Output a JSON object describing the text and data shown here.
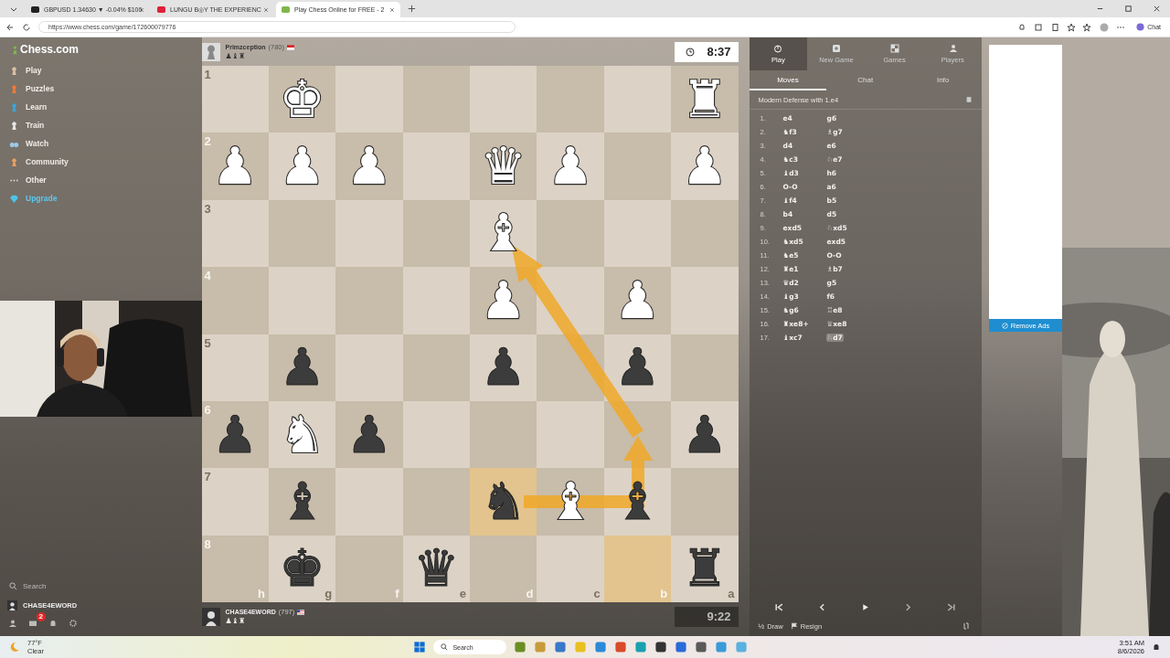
{
  "browser": {
    "tabs": [
      {
        "title": "GBPUSD 1.34630 ▼ -0.04% $100",
        "kind": "finance",
        "selected": false
      },
      {
        "title": "LUNGU B◎Y THE EXPERIENC",
        "kind": "video",
        "selected": false
      },
      {
        "title": "Play Chess Online for FREE - 2",
        "kind": "chess",
        "selected": true
      }
    ],
    "url": "https://www.chess.com/game/172600079776",
    "chat_button": "Chat"
  },
  "sidebar": {
    "logo": "Chess.com",
    "items": [
      {
        "label": "Play",
        "kind": "play"
      },
      {
        "label": "Puzzles",
        "kind": "puzzles"
      },
      {
        "label": "Learn",
        "kind": "learn"
      },
      {
        "label": "Train",
        "kind": "train"
      },
      {
        "label": "Watch",
        "kind": "watch"
      },
      {
        "label": "Community",
        "kind": "community"
      },
      {
        "label": "Other",
        "kind": "other"
      },
      {
        "label": "Upgrade",
        "kind": "upgrade"
      }
    ],
    "search": {
      "placeholder": "Search"
    },
    "user": "CHASE4EWORD",
    "message_badge": "2"
  },
  "top_player": {
    "name": "Primzception",
    "rating": "(780)",
    "captured": "♟♝♜",
    "clock": "8:37",
    "active": true
  },
  "bottom_player": {
    "name": "CHASE4EWORD",
    "rating": "(797)",
    "captured": "♟♝♜",
    "clock": "9:22",
    "active": false
  },
  "board": {
    "files": [
      "h",
      "g",
      "f",
      "e",
      "d",
      "c",
      "b",
      "a"
    ],
    "ranks": [
      {
        "label": "1",
        "squares": [
          {
            "highlighted": false
          },
          {
            "piece": "♚",
            "kind": "white",
            "highlighted": false
          },
          {
            "highlighted": false
          },
          {
            "highlighted": false
          },
          {
            "highlighted": false
          },
          {
            "highlighted": false
          },
          {
            "highlighted": false
          },
          {
            "piece": "♜",
            "kind": "white",
            "highlighted": false
          }
        ]
      },
      {
        "label": "2",
        "squares": [
          {
            "piece": "♟",
            "kind": "white",
            "highlighted": false
          },
          {
            "piece": "♟",
            "kind": "white",
            "highlighted": false
          },
          {
            "piece": "♟",
            "kind": "white",
            "highlighted": false
          },
          {
            "highlighted": false
          },
          {
            "piece": "♛",
            "kind": "white",
            "highlighted": false
          },
          {
            "piece": "♟",
            "kind": "white",
            "highlighted": false
          },
          {
            "highlighted": false
          },
          {
            "piece": "♟",
            "kind": "white",
            "highlighted": false
          }
        ]
      },
      {
        "label": "3",
        "squares": [
          {
            "highlighted": false
          },
          {
            "highlighted": false
          },
          {
            "highlighted": false
          },
          {
            "highlighted": false
          },
          {
            "piece": "♝",
            "kind": "white",
            "highlighted": false
          },
          {
            "highlighted": false
          },
          {
            "highlighted": false
          },
          {
            "highlighted": false
          }
        ]
      },
      {
        "label": "4",
        "squares": [
          {
            "highlighted": false
          },
          {
            "highlighted": false
          },
          {
            "highlighted": false
          },
          {
            "highlighted": false
          },
          {
            "piece": "♟",
            "kind": "white",
            "highlighted": false
          },
          {
            "highlighted": false
          },
          {
            "piece": "♟",
            "kind": "white",
            "highlighted": false
          },
          {
            "highlighted": false
          }
        ]
      },
      {
        "label": "5",
        "squares": [
          {
            "highlighted": false
          },
          {
            "piece": "♟",
            "kind": "black",
            "highlighted": false
          },
          {
            "highlighted": false
          },
          {
            "highlighted": false
          },
          {
            "piece": "♟",
            "kind": "black",
            "highlighted": false
          },
          {
            "highlighted": false
          },
          {
            "piece": "♟",
            "kind": "black",
            "highlighted": false
          },
          {
            "highlighted": false
          }
        ]
      },
      {
        "label": "6",
        "squares": [
          {
            "piece": "♟",
            "kind": "black",
            "highlighted": false
          },
          {
            "piece": "♞",
            "kind": "white",
            "highlighted": false
          },
          {
            "piece": "♟",
            "kind": "black",
            "highlighted": false
          },
          {
            "highlighted": false
          },
          {
            "highlighted": false
          },
          {
            "highlighted": false
          },
          {
            "highlighted": false
          },
          {
            "piece": "♟",
            "kind": "black",
            "highlighted": false
          }
        ]
      },
      {
        "label": "7",
        "squares": [
          {
            "highlighted": false
          },
          {
            "piece": "♝",
            "kind": "black",
            "highlighted": false
          },
          {
            "highlighted": false
          },
          {
            "highlighted": false
          },
          {
            "piece": "♞",
            "kind": "black",
            "highlighted": true
          },
          {
            "piece": "♝",
            "kind": "white",
            "highlighted": false
          },
          {
            "piece": "♝",
            "kind": "black",
            "highlighted": false
          },
          {
            "highlighted": false
          }
        ]
      },
      {
        "label": "8",
        "squares": [
          {
            "highlighted": false
          },
          {
            "piece": "♚",
            "kind": "black",
            "highlighted": false
          },
          {
            "highlighted": false
          },
          {
            "piece": "♛",
            "kind": "black",
            "highlighted": false
          },
          {
            "highlighted": false
          },
          {
            "highlighted": false
          },
          {
            "highlighted": true
          },
          {
            "piece": "♜",
            "kind": "black",
            "highlighted": false
          }
        ]
      }
    ]
  },
  "panel": {
    "nav": [
      {
        "label": "Play",
        "kind": "play",
        "selected": true
      },
      {
        "label": "New Game",
        "kind": "new",
        "selected": false
      },
      {
        "label": "Games",
        "kind": "games",
        "selected": false
      },
      {
        "label": "Players",
        "kind": "players",
        "selected": false
      }
    ],
    "tabs": [
      {
        "label": "Moves",
        "selected": true
      },
      {
        "label": "Chat",
        "selected": false
      },
      {
        "label": "Info",
        "selected": false
      }
    ],
    "opening": "Modern Defense with 1.e4",
    "moves": [
      {
        "number": "1.",
        "white": {
          "text": "e4",
          "selected": false
        },
        "black": {
          "text": "g6",
          "selected": false
        }
      },
      {
        "number": "2.",
        "white": {
          "text": "♞f3",
          "selected": false
        },
        "black": {
          "text": "♗g7",
          "selected": false
        }
      },
      {
        "number": "3.",
        "white": {
          "text": "d4",
          "selected": false
        },
        "black": {
          "text": "e6",
          "selected": false
        }
      },
      {
        "number": "4.",
        "white": {
          "text": "♞c3",
          "selected": false
        },
        "black": {
          "text": "♘e7",
          "selected": false
        }
      },
      {
        "number": "5.",
        "white": {
          "text": "♝d3",
          "selected": false
        },
        "black": {
          "text": "h6",
          "selected": false
        }
      },
      {
        "number": "6.",
        "white": {
          "text": "O-O",
          "selected": false
        },
        "black": {
          "text": "a6",
          "selected": false
        }
      },
      {
        "number": "7.",
        "white": {
          "text": "♝f4",
          "selected": false
        },
        "black": {
          "text": "b5",
          "selected": false
        }
      },
      {
        "number": "8.",
        "white": {
          "text": "b4",
          "selected": false
        },
        "black": {
          "text": "d5",
          "selected": false
        }
      },
      {
        "number": "9.",
        "white": {
          "text": "exd5",
          "selected": false
        },
        "black": {
          "text": "♘xd5",
          "selected": false
        }
      },
      {
        "number": "10.",
        "white": {
          "text": "♞xd5",
          "selected": false
        },
        "black": {
          "text": "exd5",
          "selected": false
        }
      },
      {
        "number": "11.",
        "white": {
          "text": "♞e5",
          "selected": false
        },
        "black": {
          "text": "O-O",
          "selected": false
        }
      },
      {
        "number": "12.",
        "white": {
          "text": "♜e1",
          "selected": false
        },
        "black": {
          "text": "♗b7",
          "selected": false
        }
      },
      {
        "number": "13.",
        "white": {
          "text": "♛d2",
          "selected": false
        },
        "black": {
          "text": "g5",
          "selected": false
        }
      },
      {
        "number": "14.",
        "white": {
          "text": "♝g3",
          "selected": false
        },
        "black": {
          "text": "f6",
          "selected": false
        }
      },
      {
        "number": "15.",
        "white": {
          "text": "♞g6",
          "selected": false
        },
        "black": {
          "text": "♖e8",
          "selected": false
        }
      },
      {
        "number": "16.",
        "white": {
          "text": "♜xe8+",
          "selected": false
        },
        "black": {
          "text": "♕xe8",
          "selected": false
        }
      },
      {
        "number": "17.",
        "white": {
          "text": "♝xc7",
          "selected": false
        },
        "black": {
          "text": "♘d7",
          "selected": true
        }
      }
    ],
    "draw_symbol": "½",
    "draw": "Draw",
    "resign": "Resign"
  },
  "ad": {
    "button": "Remove Ads"
  },
  "taskbar": {
    "temperature": "77°F",
    "weather": "Clear",
    "search": "Search",
    "time": "3:51 AM",
    "date": "8/6/2026"
  }
}
